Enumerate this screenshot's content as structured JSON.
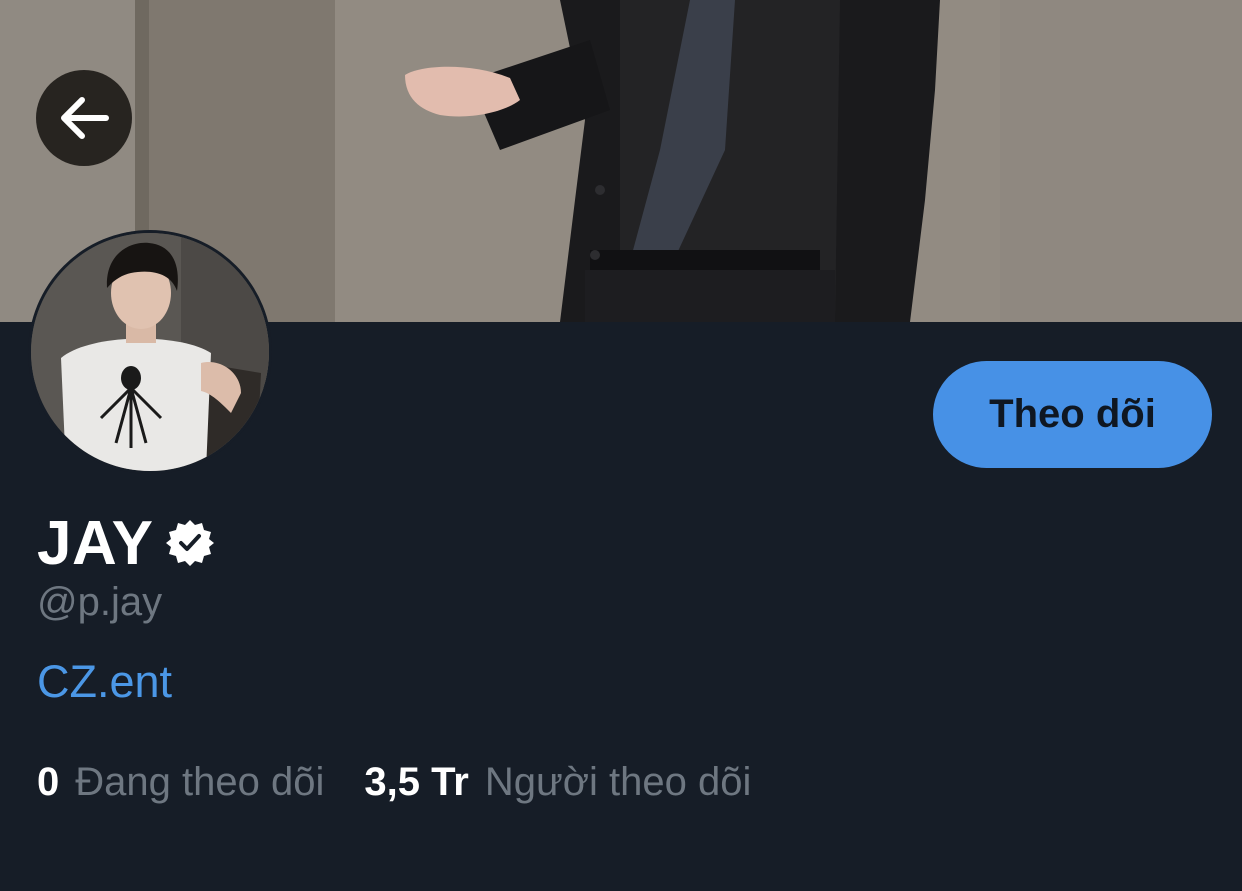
{
  "profile": {
    "display_name": "JAY",
    "handle": "@p.jay",
    "bio_link": "CZ.ent",
    "verified": true
  },
  "actions": {
    "follow_label": "Theo dõi"
  },
  "stats": {
    "following_count": "0",
    "following_label": "Đang theo dõi",
    "followers_count": "3,5 Tr",
    "followers_label": "Người theo dõi"
  },
  "icons": {
    "back": "back-arrow-icon",
    "verified": "verified-badge-icon"
  },
  "colors": {
    "background": "#161d27",
    "accent": "#4791e6",
    "link": "#4b97e6",
    "muted_text": "#6e7781",
    "primary_text": "#ffffff"
  }
}
